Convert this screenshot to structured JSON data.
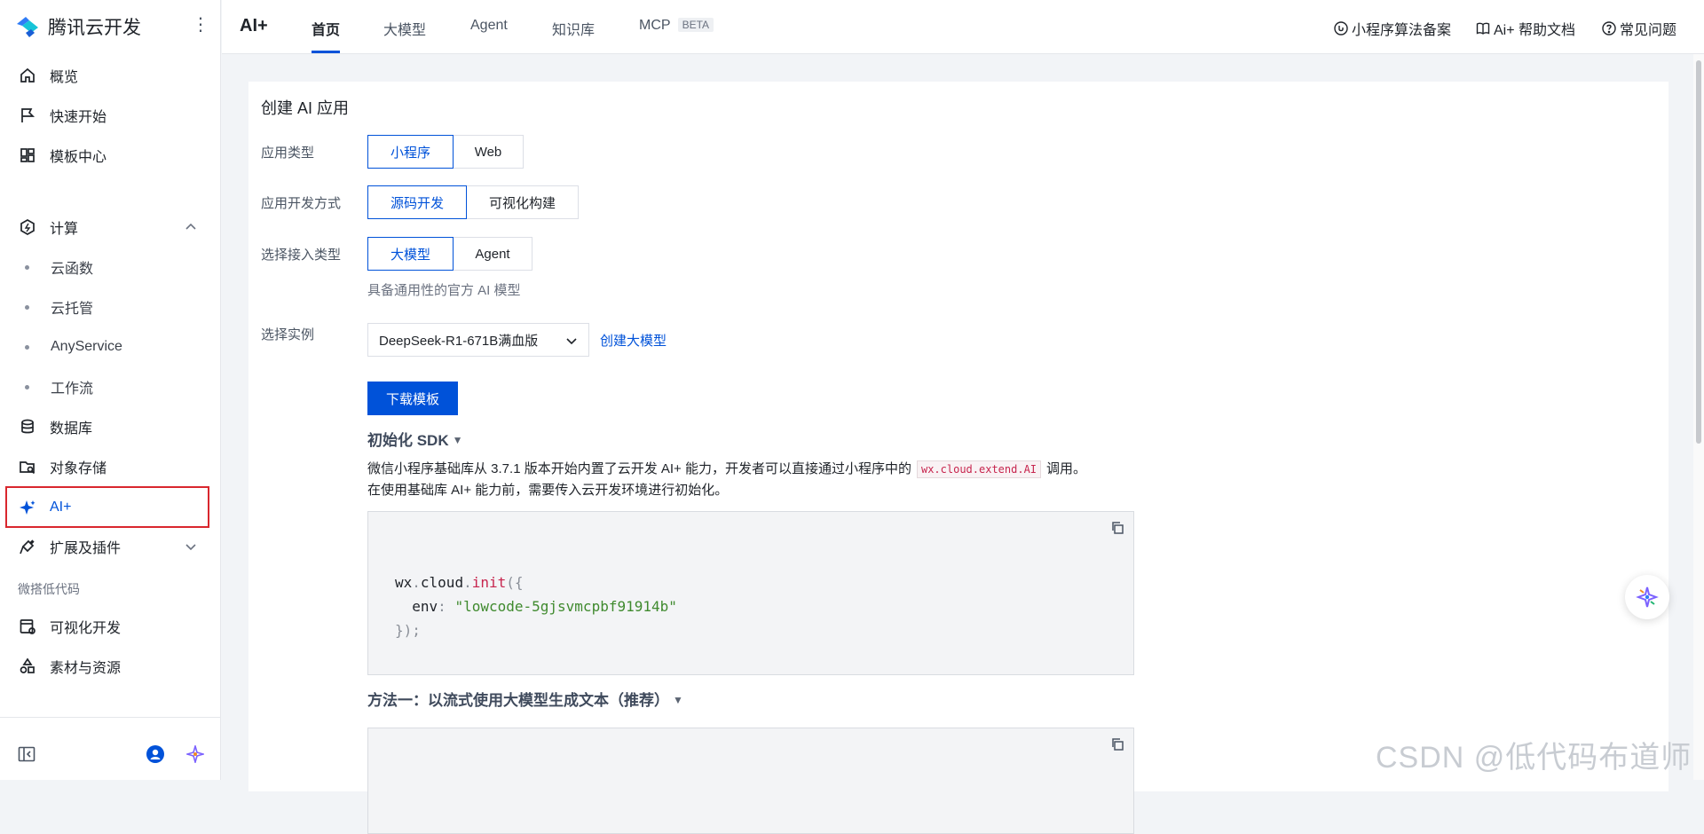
{
  "brand": {
    "name": "腾讯云开发",
    "more": "⋮"
  },
  "sidebar": {
    "items": [
      {
        "label": "概览",
        "icon": "home-icon"
      },
      {
        "label": "快速开始",
        "icon": "flag-icon"
      },
      {
        "label": "模板中心",
        "icon": "template-icon"
      },
      {
        "label": "计算",
        "icon": "compute-icon"
      },
      {
        "label": "云函数"
      },
      {
        "label": "云托管"
      },
      {
        "label": "AnyService"
      },
      {
        "label": "工作流"
      },
      {
        "label": "数据库",
        "icon": "database-icon"
      },
      {
        "label": "对象存储",
        "icon": "storage-icon"
      },
      {
        "label": "AI+",
        "icon": "sparkle-icon"
      },
      {
        "label": "扩展及插件",
        "icon": "plugin-icon"
      }
    ],
    "section_label": "微搭低代码",
    "lowcode_items": [
      {
        "label": "可视化开发",
        "icon": "visual-dev-icon"
      },
      {
        "label": "素材与资源",
        "icon": "assets-icon"
      }
    ]
  },
  "topbar": {
    "title": "AI+",
    "tabs": [
      {
        "label": "首页"
      },
      {
        "label": "大模型"
      },
      {
        "label": "Agent"
      },
      {
        "label": "知识库"
      },
      {
        "label": "MCP",
        "badge": "BETA"
      }
    ],
    "links": [
      {
        "label": "小程序算法备案"
      },
      {
        "label": "Ai+ 帮助文档"
      },
      {
        "label": "常见问题"
      }
    ]
  },
  "form": {
    "title": "创建 AI 应用",
    "app_type_label": "应用类型",
    "app_type_options": [
      "小程序",
      "Web"
    ],
    "dev_mode_label": "应用开发方式",
    "dev_mode_options": [
      "源码开发",
      "可视化构建"
    ],
    "access_type_label": "选择接入类型",
    "access_type_options": [
      "大模型",
      "Agent"
    ],
    "access_type_hint": "具备通用性的官方 AI 模型",
    "instance_label": "选择实例",
    "instance_value": "DeepSeek-R1-671B满血版",
    "create_model_link": "创建大模型",
    "download_button": "下载模板"
  },
  "sdk": {
    "heading": "初始化 SDK",
    "para1_before": "微信小程序基础库从 3.7.1 版本开始内置了云开发 AI+ 能力，开发者可以直接通过小程序中的",
    "para1_code": "wx.cloud.extend.AI",
    "para1_after": "调用。",
    "para2": "在使用基础库 AI+ 能力前，需要传入云开发环境进行初始化。",
    "code": {
      "l1_obj": "wx",
      "l1_dot1": ".",
      "l1_cloud": "cloud",
      "l1_dot2": ".",
      "l1_fn": "init",
      "l1_open": "({",
      "l2_key": "  env",
      "l2_colon": ": ",
      "l2_val": "\"lowcode-5gjsvmcpbf91914b\"",
      "l3": "});"
    }
  },
  "method1": {
    "heading": "方法一：以流式使用大模型生成文本（推荐）"
  },
  "watermark": "CSDN @低代码布道师"
}
